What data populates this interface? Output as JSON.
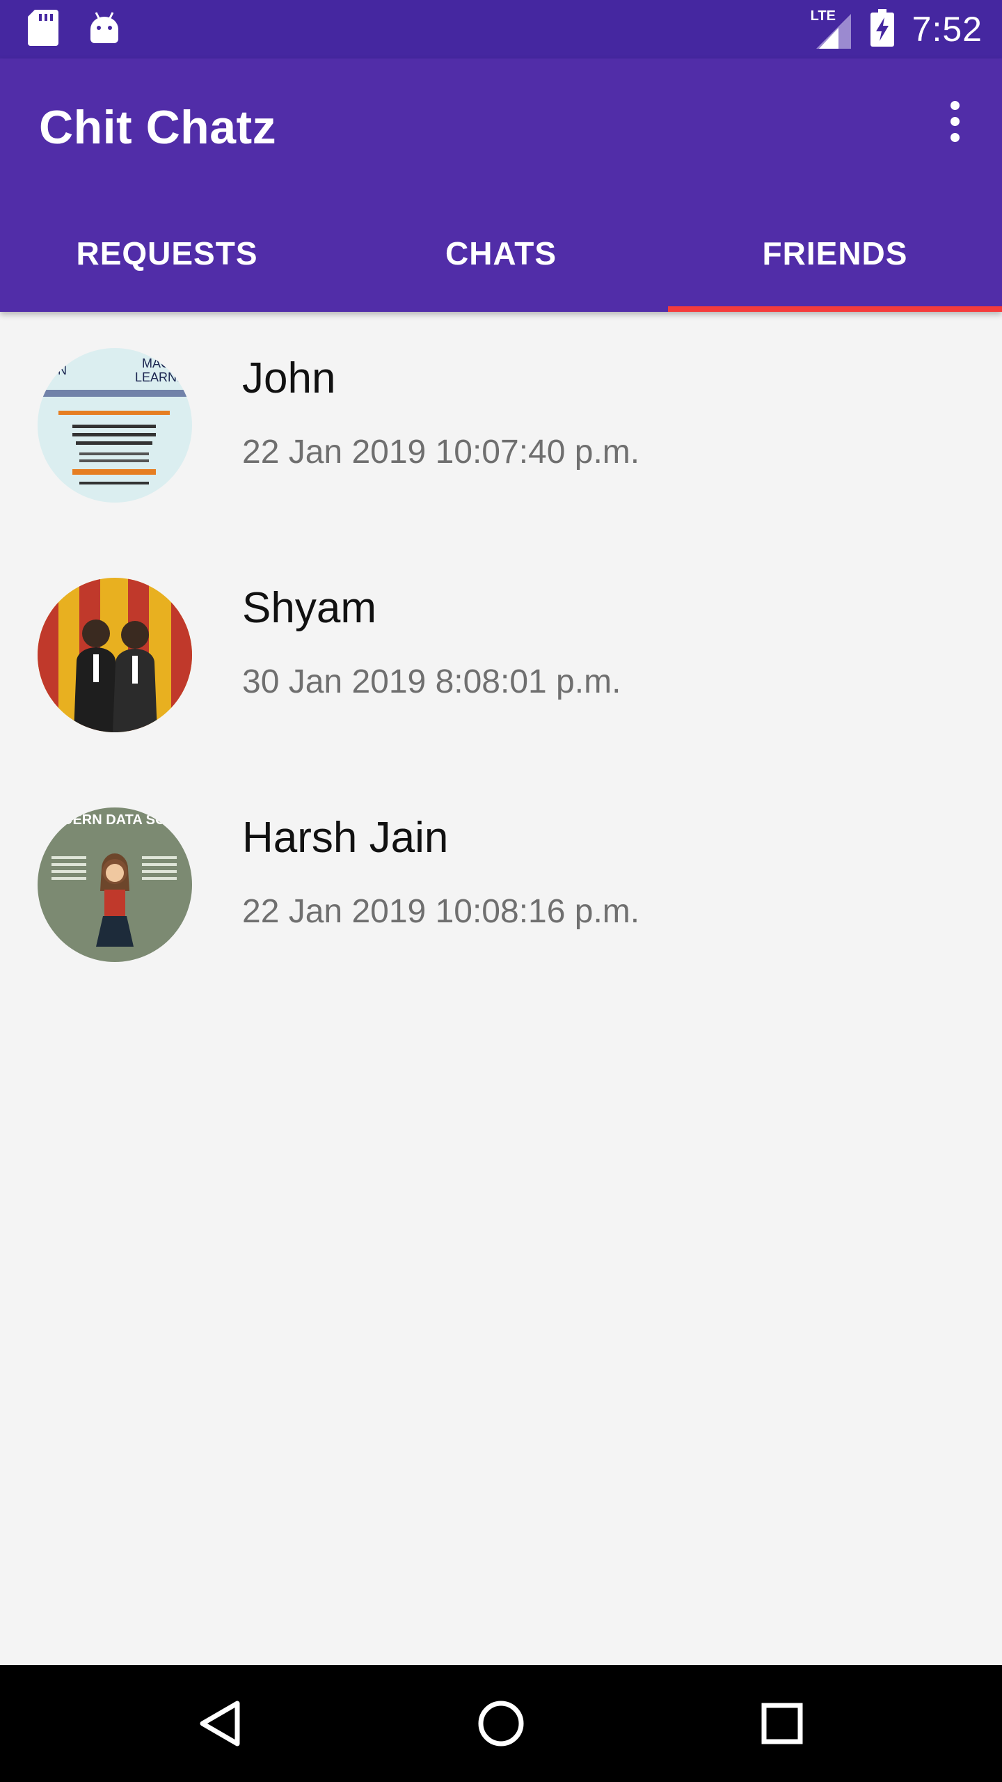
{
  "status_bar": {
    "time": "7:52",
    "network": "LTE",
    "icons": [
      "sd-card-icon",
      "android-icon",
      "signal-icon",
      "battery-charging-icon"
    ]
  },
  "app_bar": {
    "title": "Chit Chatz",
    "overflow_icon": "more-vert-icon"
  },
  "tabs": [
    {
      "label": "REQUESTS",
      "selected": false
    },
    {
      "label": "CHATS",
      "selected": false
    },
    {
      "label": "FRIENDS",
      "selected": true
    }
  ],
  "friends": [
    {
      "name": "John",
      "date": "22 Jan 2019 10:07:40 p.m.",
      "avatar": "course-poster-avatar",
      "avatar_text": [
        "ION",
        "MACH",
        "LEARNI"
      ]
    },
    {
      "name": "Shyam",
      "date": "30 Jan 2019 8:08:01 p.m.",
      "avatar": "photo-two-men-avatar"
    },
    {
      "name": "Harsh Jain",
      "date": "22 Jan 2019 10:08:16 p.m.",
      "avatar": "data-science-poster-avatar",
      "avatar_text": [
        "DERN DATA SCIEN"
      ]
    }
  ],
  "nav_bar": {
    "icons": [
      "back-icon",
      "home-icon",
      "recents-icon"
    ]
  },
  "colors": {
    "status_bar": "#4527a0",
    "app_bar": "#512da8",
    "tab_indicator": "#f43b3b",
    "background": "#f4f4f4"
  }
}
